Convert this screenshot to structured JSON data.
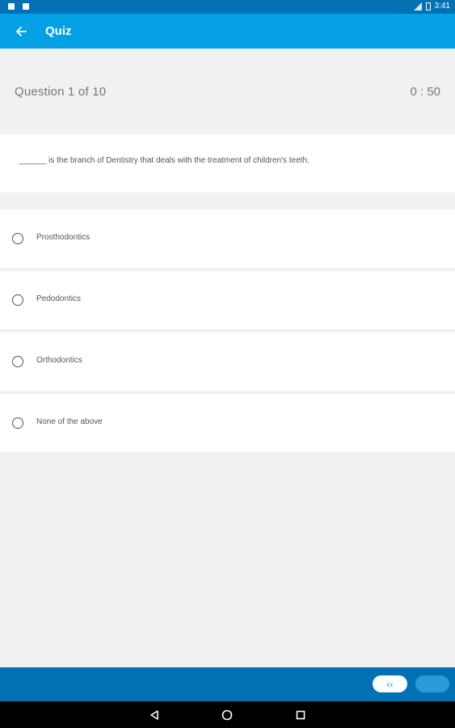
{
  "status_bar": {
    "time": "3:41"
  },
  "app_bar": {
    "title": "Quiz"
  },
  "quiz": {
    "counter": "Question 1 of  10",
    "timer": "0 : 50",
    "question": "______ is the branch of Dentistry that deals with the treatment of children's teeth.",
    "options": [
      {
        "label": "Prosthodontics"
      },
      {
        "label": "Pedodontics"
      },
      {
        "label": "Orthodontics"
      },
      {
        "label": "None of the above"
      }
    ]
  },
  "bottom_bar": {
    "prev_label": "‹‹"
  },
  "colors": {
    "primary": "#03a0e6",
    "primary_dark": "#0271b4",
    "background": "#f1f1f1"
  }
}
